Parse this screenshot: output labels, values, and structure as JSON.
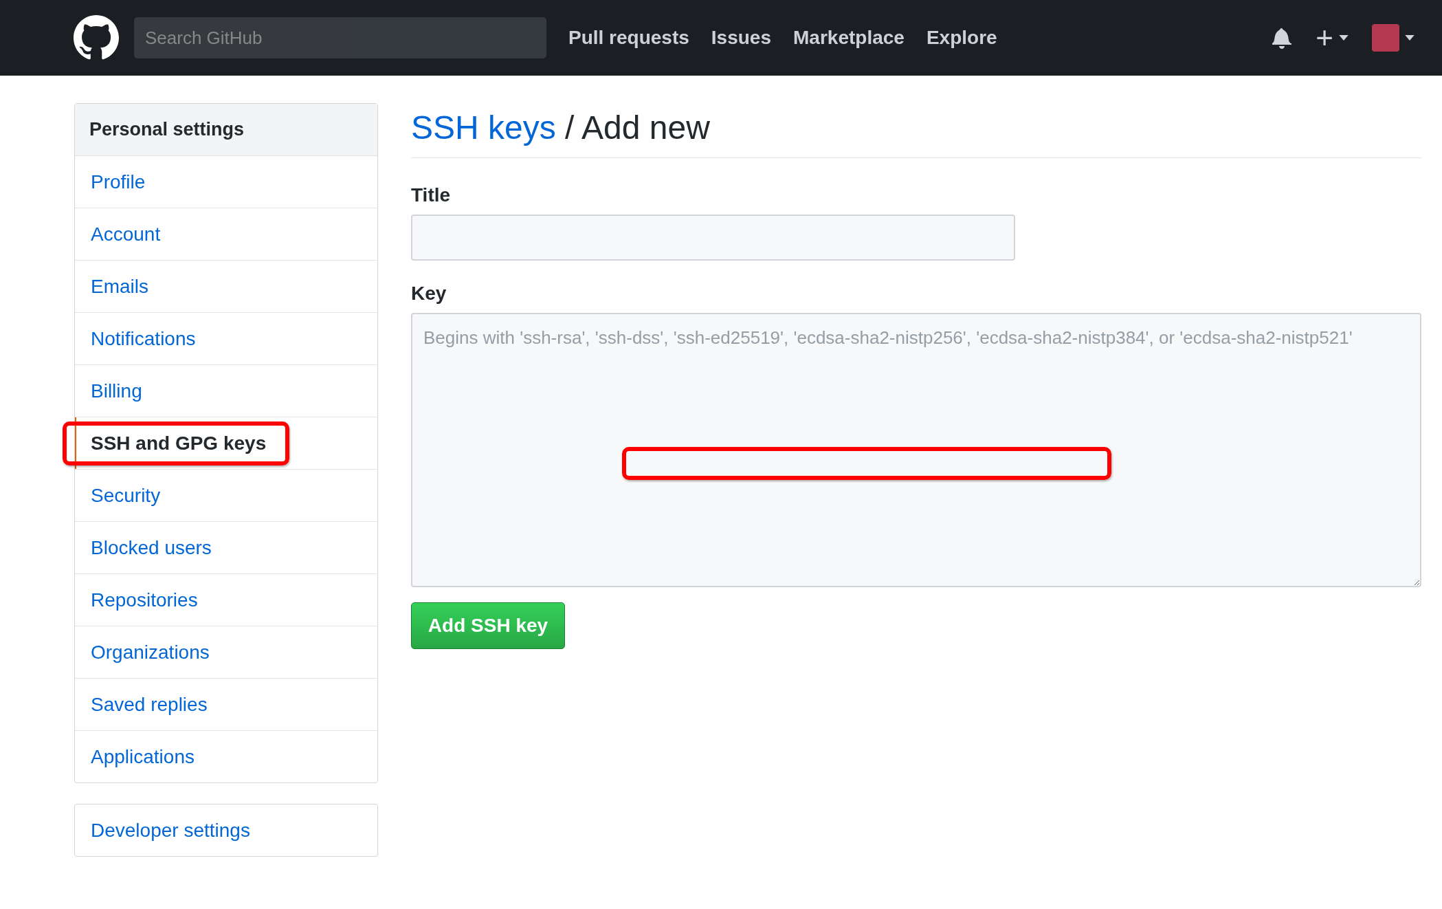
{
  "header": {
    "search": {
      "placeholder": "Search GitHub"
    },
    "nav": [
      "Pull requests",
      "Issues",
      "Marketplace",
      "Explore"
    ],
    "new_symbol": "+"
  },
  "sidebar": {
    "heading": "Personal settings",
    "items": [
      {
        "label": "Profile",
        "selected": false,
        "highlighted": false
      },
      {
        "label": "Account",
        "selected": false,
        "highlighted": false
      },
      {
        "label": "Emails",
        "selected": false,
        "highlighted": false
      },
      {
        "label": "Notifications",
        "selected": false,
        "highlighted": false
      },
      {
        "label": "Billing",
        "selected": false,
        "highlighted": false
      },
      {
        "label": "SSH and GPG keys",
        "selected": true,
        "highlighted": true
      },
      {
        "label": "Security",
        "selected": false,
        "highlighted": false
      },
      {
        "label": "Blocked users",
        "selected": false,
        "highlighted": false
      },
      {
        "label": "Repositories",
        "selected": false,
        "highlighted": false
      },
      {
        "label": "Organizations",
        "selected": false,
        "highlighted": false
      },
      {
        "label": "Saved replies",
        "selected": false,
        "highlighted": false
      },
      {
        "label": "Applications",
        "selected": false,
        "highlighted": false
      }
    ],
    "developer_settings": "Developer settings"
  },
  "main": {
    "breadcrumb_link": "SSH keys",
    "title": "/ Add new",
    "title_field": {
      "label": "Title"
    },
    "key_field": {
      "label": "Key",
      "placeholder": "Begins with 'ssh-rsa', 'ssh-dss', 'ssh-ed25519', 'ecdsa-sha2-nistp256', 'ecdsa-sha2-nistp384', or 'ecdsa-sha2-nistp521'",
      "highlighted": true
    },
    "submit": "Add SSH key"
  }
}
